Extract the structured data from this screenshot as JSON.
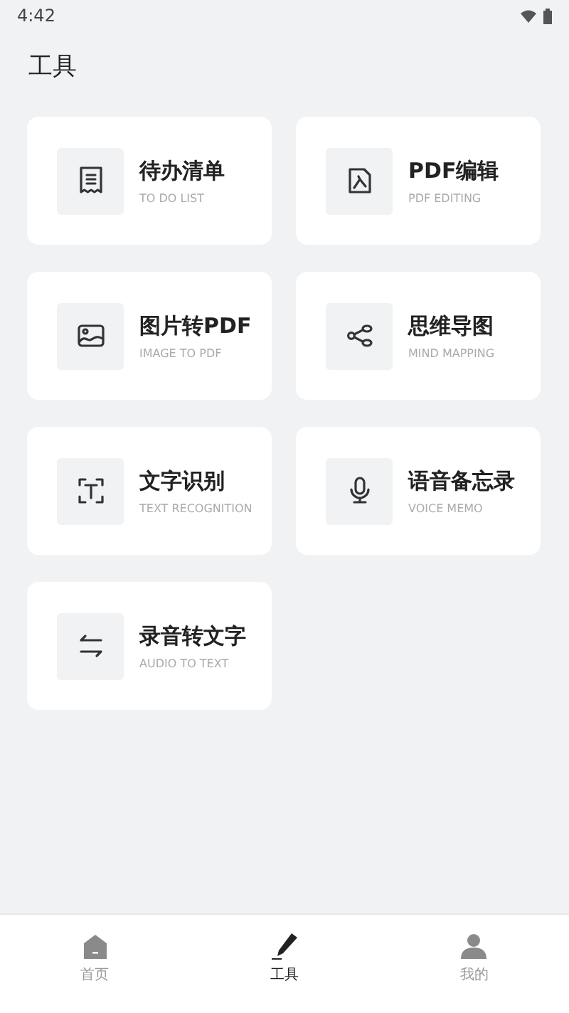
{
  "status_bar": {
    "time": "4:42"
  },
  "page_title": "工具",
  "tools": [
    {
      "title": "待办清单",
      "subtitle": "TO DO LIST"
    },
    {
      "title": "PDF编辑",
      "subtitle": "PDF EDITING"
    },
    {
      "title": "图片转PDF",
      "subtitle": "IMAGE TO PDF"
    },
    {
      "title": "思维导图",
      "subtitle": "MIND MAPPING"
    },
    {
      "title": "文字识别",
      "subtitle": "TEXT RECOGNITION"
    },
    {
      "title": "语音备忘录",
      "subtitle": "VOICE MEMO"
    },
    {
      "title": "录音转文字",
      "subtitle": "AUDIO TO TEXT"
    }
  ],
  "bottom_nav": [
    {
      "label": "首页",
      "selected": false
    },
    {
      "label": "工具",
      "selected": true
    },
    {
      "label": "我的",
      "selected": false
    }
  ]
}
